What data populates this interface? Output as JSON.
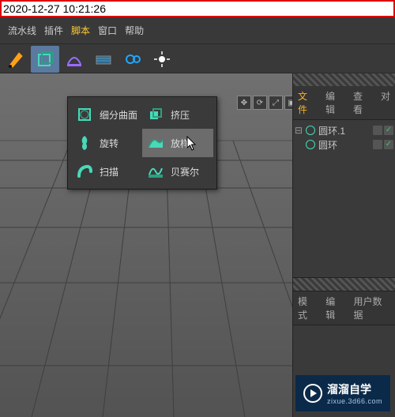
{
  "timestamp": "2020-12-27 10:21:26",
  "menu": {
    "items": [
      "流水线",
      "插件",
      "脚本",
      "窗口",
      "帮助"
    ],
    "active_index": 2
  },
  "popup": {
    "items": [
      {
        "label": "细分曲面",
        "icon": "subdiv-icon"
      },
      {
        "label": "挤压",
        "icon": "extrude-icon"
      },
      {
        "label": "旋转",
        "icon": "lathe-icon"
      },
      {
        "label": "放样",
        "icon": "loft-icon"
      },
      {
        "label": "扫描",
        "icon": "sweep-icon"
      },
      {
        "label": "贝赛尔",
        "icon": "bezier-icon"
      }
    ],
    "hover_index": 3
  },
  "right_panel": {
    "tabs_top": [
      "文件",
      "编辑",
      "查看",
      "对"
    ],
    "tabs_top_active": 0,
    "tabs_bottom": [
      "模式",
      "编辑",
      "用户数据"
    ]
  },
  "objects": [
    {
      "name": "圆环.1"
    },
    {
      "name": "圆环"
    }
  ],
  "watermark": {
    "title": "溜溜自学",
    "sub": "zixue.3d66.com"
  }
}
